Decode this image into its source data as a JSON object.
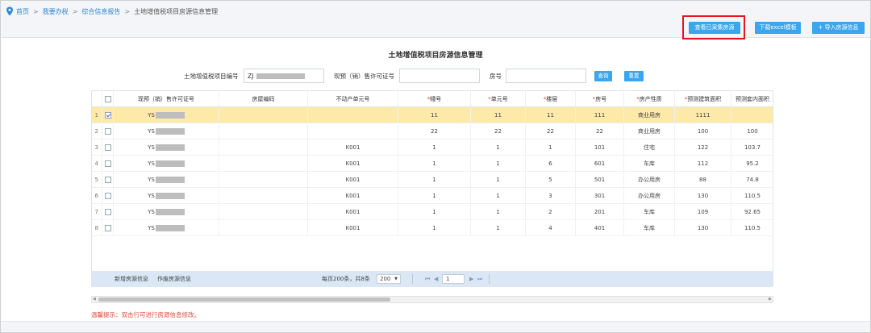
{
  "breadcrumb": {
    "home": "首页",
    "level2": "我要办税",
    "level3": "综合信息报告",
    "current": "土地增值税项目房源信息管理",
    "separator": ">"
  },
  "toolbar": {
    "view_collected": "查看已采集房源",
    "download_excel": "下载excel模板",
    "import": "+ 导入房源信息"
  },
  "page_title": "土地增值税项目房源信息管理",
  "search": {
    "project_no_label": "土地增值税项目编号",
    "project_no_value": "ZJ",
    "permit_label": "现预（销）售许可证号",
    "permit_value": "",
    "room_label": "房号",
    "room_value": "",
    "query_button": "查询",
    "reset_button": "重置"
  },
  "table": {
    "columns": [
      {
        "label": "现预（销）售许可证号",
        "required": false
      },
      {
        "label": "房屋编码",
        "required": false
      },
      {
        "label": "不动产单元号",
        "required": false
      },
      {
        "label": "幢号",
        "required": true
      },
      {
        "label": "单元号",
        "required": true
      },
      {
        "label": "楼层",
        "required": true
      },
      {
        "label": "房号",
        "required": true
      },
      {
        "label": "房产性质",
        "required": true
      },
      {
        "label": "预测建筑面积",
        "required": true
      },
      {
        "label": "预测套内面积",
        "required": false
      }
    ],
    "rows": [
      {
        "num": "1",
        "checked": true,
        "permit": "YS",
        "code": "",
        "unit": "",
        "building": "11",
        "unitno": "11",
        "floor": "11",
        "room": "111",
        "nature": "商业用房",
        "area": "1111",
        "inner": ""
      },
      {
        "num": "2",
        "checked": false,
        "permit": "YS",
        "code": "",
        "unit": "",
        "building": "22",
        "unitno": "22",
        "floor": "22",
        "room": "22",
        "nature": "商业用房",
        "area": "100",
        "inner": "100"
      },
      {
        "num": "3",
        "checked": false,
        "permit": "YS",
        "code": "",
        "unit": "K001",
        "building": "1",
        "unitno": "1",
        "floor": "1",
        "room": "101",
        "nature": "住宅",
        "area": "122",
        "inner": "103.7"
      },
      {
        "num": "4",
        "checked": false,
        "permit": "YS",
        "code": "",
        "unit": "K001",
        "building": "1",
        "unitno": "1",
        "floor": "6",
        "room": "601",
        "nature": "车库",
        "area": "112",
        "inner": "95.2"
      },
      {
        "num": "5",
        "checked": false,
        "permit": "YS",
        "code": "",
        "unit": "K001",
        "building": "1",
        "unitno": "1",
        "floor": "5",
        "room": "501",
        "nature": "办公用房",
        "area": "88",
        "inner": "74.8"
      },
      {
        "num": "6",
        "checked": false,
        "permit": "YS",
        "code": "",
        "unit": "K001",
        "building": "1",
        "unitno": "1",
        "floor": "3",
        "room": "301",
        "nature": "办公用房",
        "area": "130",
        "inner": "110.5"
      },
      {
        "num": "7",
        "checked": false,
        "permit": "YS",
        "code": "",
        "unit": "K001",
        "building": "1",
        "unitno": "1",
        "floor": "2",
        "room": "201",
        "nature": "车库",
        "area": "109",
        "inner": "92.65"
      },
      {
        "num": "8",
        "checked": false,
        "permit": "YS",
        "code": "",
        "unit": "K001",
        "building": "1",
        "unitno": "1",
        "floor": "4",
        "room": "401",
        "nature": "车库",
        "area": "130",
        "inner": "110.5"
      }
    ]
  },
  "pager": {
    "add": "新增房源信息",
    "void": "作废房源信息",
    "summary": "每页200条，共8条",
    "page_size": "200",
    "page": "1"
  },
  "tip": "温馨提示：双击行可进行房源信息修改。",
  "colors": {
    "accent": "#3aa6f0",
    "highlight_row": "#fde9a8",
    "outline": "#e3161c",
    "required": "#e0403a",
    "pager_bg": "#dbe7f5"
  }
}
